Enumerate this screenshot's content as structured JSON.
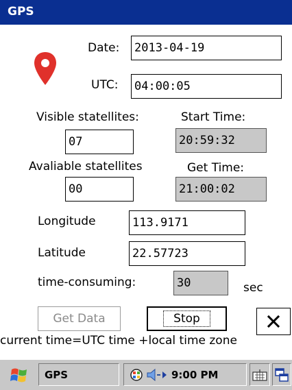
{
  "window": {
    "title": "GPS"
  },
  "date": {
    "label": "Date:",
    "value": "2013-04-19"
  },
  "utc": {
    "label": "UTC:",
    "value": "04:00:05"
  },
  "visible_satellites": {
    "label": "Visible statellites:",
    "value": "07"
  },
  "start_time": {
    "label": "Start Time:",
    "value": "20:59:32"
  },
  "available_satellites": {
    "label": "Avaliable statellites",
    "value": "00"
  },
  "get_time": {
    "label": "Get Time:",
    "value": "21:00:02"
  },
  "longitude": {
    "label": "Longitude",
    "value": "113.9171"
  },
  "latitude": {
    "label": "Latitude",
    "value": "22.57723"
  },
  "time_consuming": {
    "label": "time-consuming:",
    "value": "30",
    "unit": "sec"
  },
  "buttons": {
    "get_data": "Get Data",
    "stop": "Stop"
  },
  "note": "current time=UTC time +local time zone",
  "taskbar": {
    "app": "GPS",
    "clock": "9:00 PM"
  },
  "colors": {
    "titlebar": "#0a2f91",
    "pin": "#e0312b",
    "readonly_field": "#c8c8c8"
  },
  "icons": [
    "map-pin-icon",
    "close-icon",
    "windows-start-icon",
    "network-icon",
    "speaker-icon",
    "keyboard-icon",
    "window-switch-icon"
  ]
}
